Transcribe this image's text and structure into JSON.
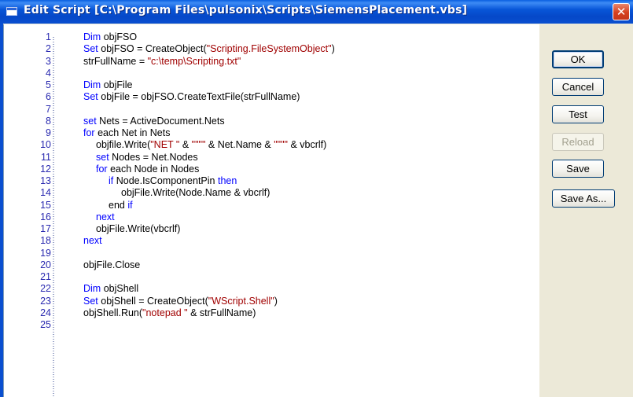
{
  "window": {
    "title": "Edit Script [C:\\Program Files\\pulsonix\\Scripts\\SiemensPlacement.vbs]",
    "close_glyph": "✕"
  },
  "buttons": {
    "ok": "OK",
    "cancel": "Cancel",
    "test": "Test",
    "reload": "Reload",
    "save": "Save",
    "save_as": "Save As..."
  },
  "editor": {
    "lines": [
      {
        "n": "1",
        "indent": 0,
        "tokens": [
          [
            "kw",
            "Dim"
          ],
          [
            "t",
            " objFSO"
          ]
        ]
      },
      {
        "n": "2",
        "indent": 0,
        "tokens": [
          [
            "kw",
            "Set"
          ],
          [
            "t",
            " objFSO = CreateObject("
          ],
          [
            "str",
            "\"Scripting.FileSystemObject\""
          ],
          [
            "t",
            ")"
          ]
        ]
      },
      {
        "n": "3",
        "indent": 0,
        "tokens": [
          [
            "t",
            "strFullName = "
          ],
          [
            "str",
            "\"c:\\temp\\Scripting.txt\""
          ]
        ]
      },
      {
        "n": "4",
        "indent": 0,
        "tokens": []
      },
      {
        "n": "5",
        "indent": 0,
        "tokens": [
          [
            "kw",
            "Dim"
          ],
          [
            "t",
            " objFile"
          ]
        ]
      },
      {
        "n": "6",
        "indent": 0,
        "tokens": [
          [
            "kw",
            "Set"
          ],
          [
            "t",
            " objFile = objFSO.CreateTextFile(strFullName)"
          ]
        ]
      },
      {
        "n": "7",
        "indent": 0,
        "tokens": []
      },
      {
        "n": "8",
        "indent": 0,
        "tokens": [
          [
            "kw",
            "set"
          ],
          [
            "t",
            " Nets = ActiveDocument.Nets"
          ]
        ]
      },
      {
        "n": "9",
        "indent": 0,
        "tokens": [
          [
            "kw",
            "for"
          ],
          [
            "t",
            " each Net in Nets"
          ]
        ]
      },
      {
        "n": "10",
        "indent": 1,
        "tokens": [
          [
            "t",
            "objfile.Write("
          ],
          [
            "str",
            "\"NET \""
          ],
          [
            "t",
            " & "
          ],
          [
            "str",
            "\"\"\"\""
          ],
          [
            "t",
            " & Net.Name & "
          ],
          [
            "str",
            "\"\"\"\""
          ],
          [
            "t",
            " & vbcrlf)"
          ]
        ]
      },
      {
        "n": "11",
        "indent": 1,
        "tokens": [
          [
            "kw",
            "set"
          ],
          [
            "t",
            " Nodes = Net.Nodes"
          ]
        ]
      },
      {
        "n": "12",
        "indent": 1,
        "tokens": [
          [
            "kw",
            "for"
          ],
          [
            "t",
            " each Node in Nodes"
          ]
        ]
      },
      {
        "n": "13",
        "indent": 2,
        "tokens": [
          [
            "kw",
            "if"
          ],
          [
            "t",
            " Node.IsComponentPin "
          ],
          [
            "kw",
            "then"
          ]
        ]
      },
      {
        "n": "14",
        "indent": 3,
        "tokens": [
          [
            "t",
            "objFile.Write(Node.Name & vbcrlf)"
          ]
        ]
      },
      {
        "n": "15",
        "indent": 2,
        "tokens": [
          [
            "t",
            "end "
          ],
          [
            "kw",
            "if"
          ]
        ]
      },
      {
        "n": "16",
        "indent": 1,
        "tokens": [
          [
            "kw",
            "next"
          ]
        ]
      },
      {
        "n": "17",
        "indent": 1,
        "tokens": [
          [
            "t",
            "objFile.Write(vbcrlf)"
          ]
        ]
      },
      {
        "n": "18",
        "indent": 0,
        "tokens": [
          [
            "kw",
            "next"
          ]
        ]
      },
      {
        "n": "19",
        "indent": 0,
        "tokens": []
      },
      {
        "n": "20",
        "indent": 0,
        "tokens": [
          [
            "t",
            "objFile.Close"
          ]
        ]
      },
      {
        "n": "21",
        "indent": 0,
        "tokens": []
      },
      {
        "n": "22",
        "indent": 0,
        "tokens": [
          [
            "kw",
            "Dim"
          ],
          [
            "t",
            " objShell"
          ]
        ]
      },
      {
        "n": "23",
        "indent": 0,
        "tokens": [
          [
            "kw",
            "Set"
          ],
          [
            "t",
            " objShell = CreateObject("
          ],
          [
            "str",
            "\"WScript.Shell\""
          ],
          [
            "t",
            ")"
          ]
        ]
      },
      {
        "n": "24",
        "indent": 0,
        "tokens": [
          [
            "t",
            "objShell.Run("
          ],
          [
            "str",
            "\"notepad \""
          ],
          [
            "t",
            " & strFullName)"
          ]
        ]
      },
      {
        "n": "25",
        "indent": 0,
        "tokens": []
      }
    ]
  },
  "colors": {
    "keyword": "#0000ff",
    "string": "#a00000",
    "line_number": "#2a2ab0",
    "titlebar": "#0856d8"
  }
}
